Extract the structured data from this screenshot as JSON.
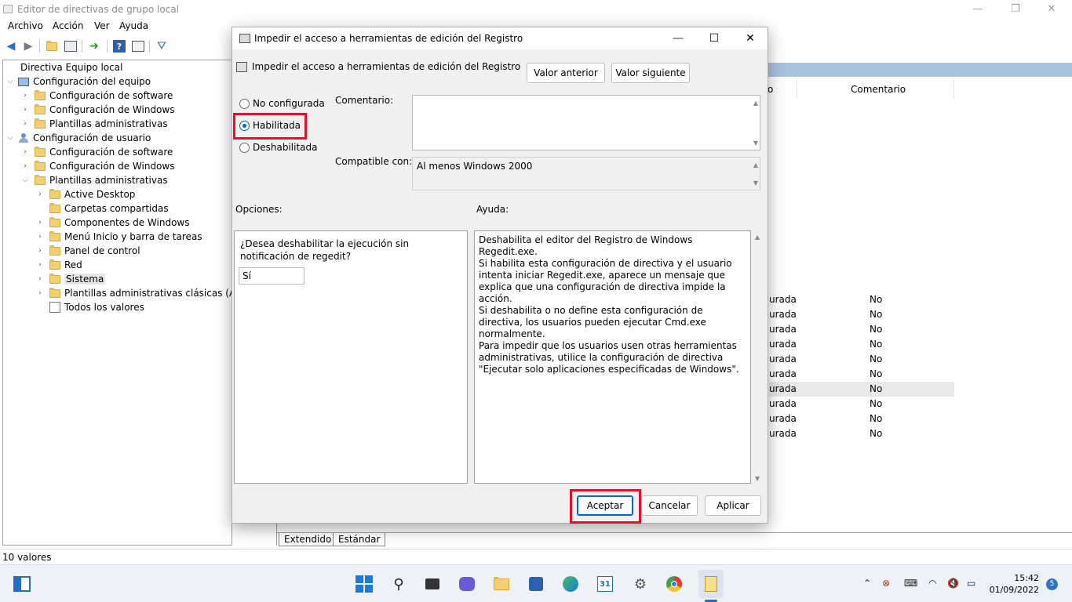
{
  "window": {
    "title": "Editor de directivas de grupo local",
    "minimize": "—",
    "restore": "❐",
    "close": "✕"
  },
  "menu": [
    "Archivo",
    "Acción",
    "Ver",
    "Ayuda"
  ],
  "toolbar": {
    "icons": [
      "back-arrow-icon",
      "forward-arrow-icon",
      "folder-up-icon",
      "show-hide-tree-icon",
      "export-list-icon",
      "help-icon",
      "properties-icon",
      "filter-icon"
    ]
  },
  "tree": {
    "root": "Directiva Equipo local",
    "computer_config": "Configuración del equipo",
    "computer_children": [
      "Configuración de software",
      "Configuración de Windows",
      "Plantillas administrativas"
    ],
    "user_config": "Configuración de usuario",
    "user_children": [
      "Configuración de software",
      "Configuración de Windows",
      "Plantillas administrativas"
    ],
    "admin_templates_children": [
      "Active Desktop",
      "Carpetas compartidas",
      "Componentes de Windows",
      "Menú Inicio y barra de tareas",
      "Panel de control",
      "Red",
      "Sistema",
      "Plantillas administrativas clásicas (ADM)"
    ],
    "all_values": "Todos los valores"
  },
  "right_pane": {
    "column_partial": "o",
    "column_comment": "Comentario",
    "rows": [
      {
        "state": "urada",
        "comment": "No"
      },
      {
        "state": "urada",
        "comment": "No"
      },
      {
        "state": "urada",
        "comment": "No"
      },
      {
        "state": "urada",
        "comment": "No"
      },
      {
        "state": "urada",
        "comment": "No"
      },
      {
        "state": "urada",
        "comment": "No"
      },
      {
        "state": "urada",
        "comment": "No"
      },
      {
        "state": "urada",
        "comment": "No"
      },
      {
        "state": "urada",
        "comment": "No"
      },
      {
        "state": "urada",
        "comment": "No"
      }
    ],
    "tabs": [
      "Extendido",
      "Estándar"
    ]
  },
  "status": "10 valores",
  "dialog": {
    "title": "Impedir el acceso a herramientas de edición del Registro",
    "policy_name": "Impedir el acceso a herramientas de edición del Registro",
    "prev_button": "Valor anterior",
    "next_button": "Valor siguiente",
    "radio_not_configured": "No configurada",
    "radio_enabled": "Habilitada",
    "radio_disabled": "Deshabilitada",
    "comment_label": "Comentario:",
    "comment_value": "",
    "compatible_label": "Compatible con:",
    "compatible_value": "Al menos Windows 2000",
    "options_label": "Opciones:",
    "help_label": "Ayuda:",
    "option_question": "¿Desea deshabilitar la ejecución sin notificación de regedit?",
    "option_selected": "Sí",
    "help_paragraphs": [
      "Deshabilita el editor del Registro de Windows Regedit.exe.",
      "Si habilita esta configuración de directiva y el usuario intenta iniciar Regedit.exe, aparece un mensaje que explica que una configuración de directiva impide la acción.",
      "Si deshabilita o no define esta configuración de directiva, los usuarios pueden ejecutar Cmd.exe normalmente.",
      "Para impedir que los usuarios usen otras herramientas administrativas, utilice la configuración de directiva \"Ejecutar solo aplicaciones especificadas de Windows\"."
    ],
    "ok_button": "Aceptar",
    "cancel_button": "Cancelar",
    "apply_button": "Aplicar",
    "maximize": "☐",
    "close": "✕",
    "highlight_color": "#e3122b"
  },
  "taskbar": {
    "apps": [
      "windows-start-icon",
      "search-icon",
      "task-view-icon",
      "chat-icon",
      "file-explorer-icon",
      "store-icon",
      "edge-icon",
      "calendar-icon",
      "settings-icon",
      "chrome-icon",
      "notepad-icon"
    ],
    "calendar_day": "31",
    "time": "15:42",
    "date": "01/09/2022",
    "notifications": "5"
  }
}
